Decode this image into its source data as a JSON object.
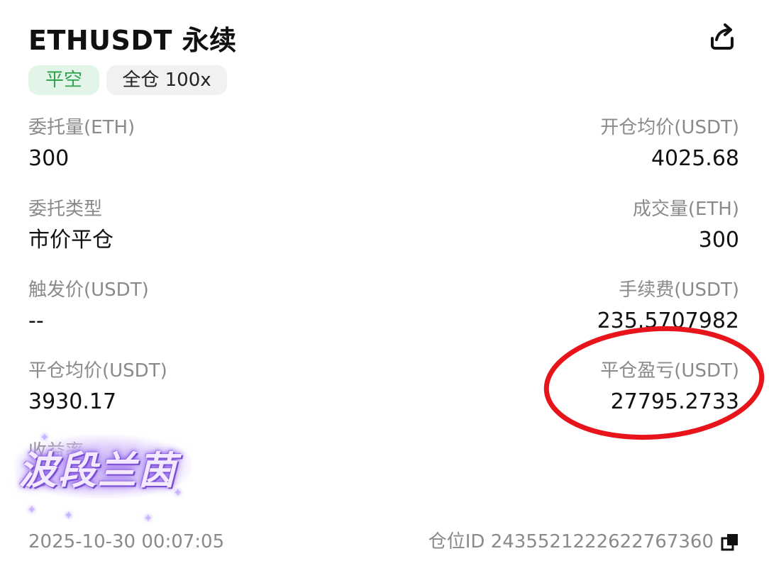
{
  "header": {
    "title": "ETHUSDT 永续",
    "share_icon": "share-icon"
  },
  "tags": {
    "side": "平空",
    "margin_mode": "全仓 100x"
  },
  "fields": {
    "order_qty": {
      "label": "委托量(ETH)",
      "value": "300"
    },
    "open_avg_price": {
      "label": "开仓均价(USDT)",
      "value": "4025.68"
    },
    "order_type": {
      "label": "委托类型",
      "value": "市价平仓"
    },
    "filled_qty": {
      "label": "成交量(ETH)",
      "value": "300"
    },
    "trigger_price": {
      "label": "触发价(USDT)",
      "value": "--"
    },
    "fee": {
      "label": "手续费(USDT)",
      "value": "235.5707982"
    },
    "close_avg_price": {
      "label": "平仓均价(USDT)",
      "value": "3930.17"
    },
    "close_pnl": {
      "label": "平仓盈亏(USDT)",
      "value": "27795.2733"
    },
    "yield": {
      "label": "收益率",
      "value": "%"
    }
  },
  "watermark": {
    "text": "波段兰茵"
  },
  "footer": {
    "time": "2025-10-30 00:07:05",
    "position_id": "仓位ID 2435521222622767360",
    "copy_icon": "copy-icon"
  },
  "colors": {
    "long_green": "#2fa34e",
    "tag_green_bg": "#e3f5e8",
    "highlight_red": "#e8141c",
    "label_gray": "#8a8a8a"
  }
}
